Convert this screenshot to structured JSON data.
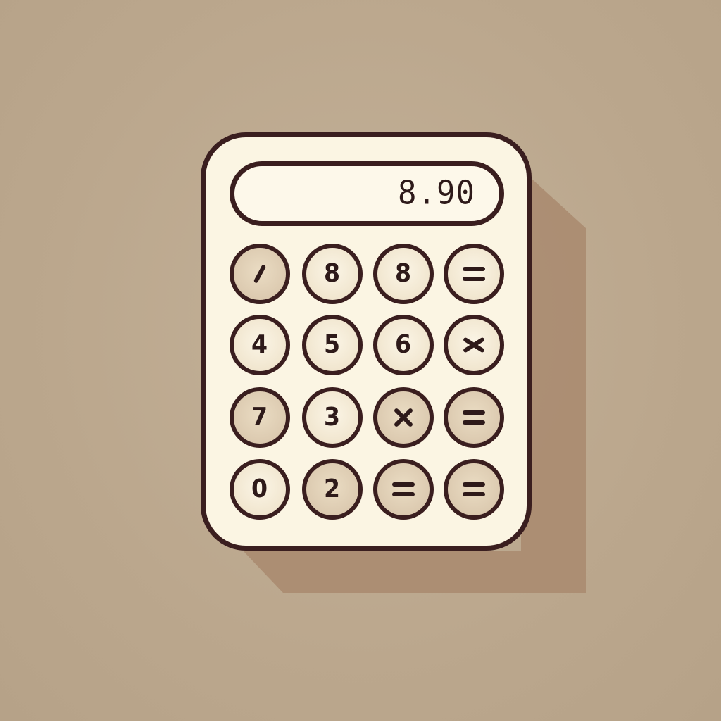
{
  "colors": {
    "background": "#bda98f",
    "calculator_body": "#fbf5e3",
    "outline": "#3a1e1f",
    "shadow": "#a8896f",
    "key_light": "#f1e6cf",
    "key_tan": "#dccab0"
  },
  "display": {
    "value": "8.90"
  },
  "keys": [
    {
      "label": "",
      "icon": "slash-icon",
      "style": "tan"
    },
    {
      "label": "8",
      "icon": "",
      "style": "light"
    },
    {
      "label": "8",
      "icon": "",
      "style": "light"
    },
    {
      "label": "",
      "icon": "equals-icon",
      "style": "light"
    },
    {
      "label": "4",
      "icon": "",
      "style": "light"
    },
    {
      "label": "5",
      "icon": "",
      "style": "light"
    },
    {
      "label": "6",
      "icon": "",
      "style": "light"
    },
    {
      "label": "",
      "icon": "multiply-icon",
      "style": "light"
    },
    {
      "label": "7",
      "icon": "",
      "style": "tan"
    },
    {
      "label": "3",
      "icon": "",
      "style": "light"
    },
    {
      "label": "",
      "icon": "multiply-icon",
      "style": "tan"
    },
    {
      "label": "",
      "icon": "equals-icon",
      "style": "tan"
    },
    {
      "label": "0",
      "icon": "",
      "style": "light"
    },
    {
      "label": "2",
      "icon": "",
      "style": "tan"
    },
    {
      "label": "",
      "icon": "equals-icon",
      "style": "tan"
    },
    {
      "label": "",
      "icon": "equals-icon",
      "style": "tan"
    }
  ]
}
